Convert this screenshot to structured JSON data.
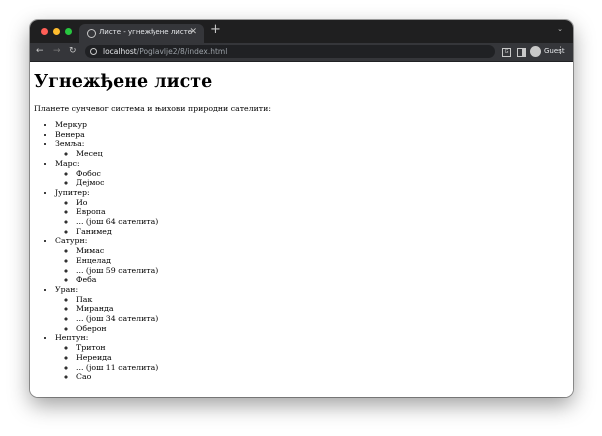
{
  "browser": {
    "tab_title": "Листе - угнежђене листе",
    "new_tab_label": "+",
    "url_host": "localhost",
    "url_path": "/Poglavlje2/8/index.html",
    "profile_label": "Guest"
  },
  "icons": [
    "globe-icon",
    "close-icon",
    "plus-icon",
    "chevron-down-icon",
    "back-icon",
    "forward-icon",
    "reload-icon",
    "info-icon",
    "translate-icon",
    "side-panel-icon",
    "avatar-icon",
    "more-menu-icon"
  ],
  "page": {
    "heading": "Угнежђене листе",
    "intro": "Планете сунчевог система и њихови природни сателити:",
    "planets": [
      {
        "name": "Меркур",
        "moons": []
      },
      {
        "name": "Венера",
        "moons": []
      },
      {
        "name": "Земља:",
        "moons": [
          "Месец"
        ]
      },
      {
        "name": "Марс:",
        "moons": [
          "Фобос",
          "Дејмос"
        ]
      },
      {
        "name": "Јупитер:",
        "moons": [
          "Ио",
          "Европа",
          "... (још 64 сателита)",
          "Ганимед"
        ]
      },
      {
        "name": "Сатурн:",
        "moons": [
          "Мимас",
          "Енцелад",
          "... (још 59 сателита)",
          "Феба"
        ]
      },
      {
        "name": "Уран:",
        "moons": [
          "Пак",
          "Миранда",
          "... (још 34 сателита)",
          "Оберон"
        ]
      },
      {
        "name": "Нептун:",
        "moons": [
          "Тритон",
          "Нереида",
          "... (још 11 сателита)",
          "Сао"
        ]
      }
    ]
  }
}
